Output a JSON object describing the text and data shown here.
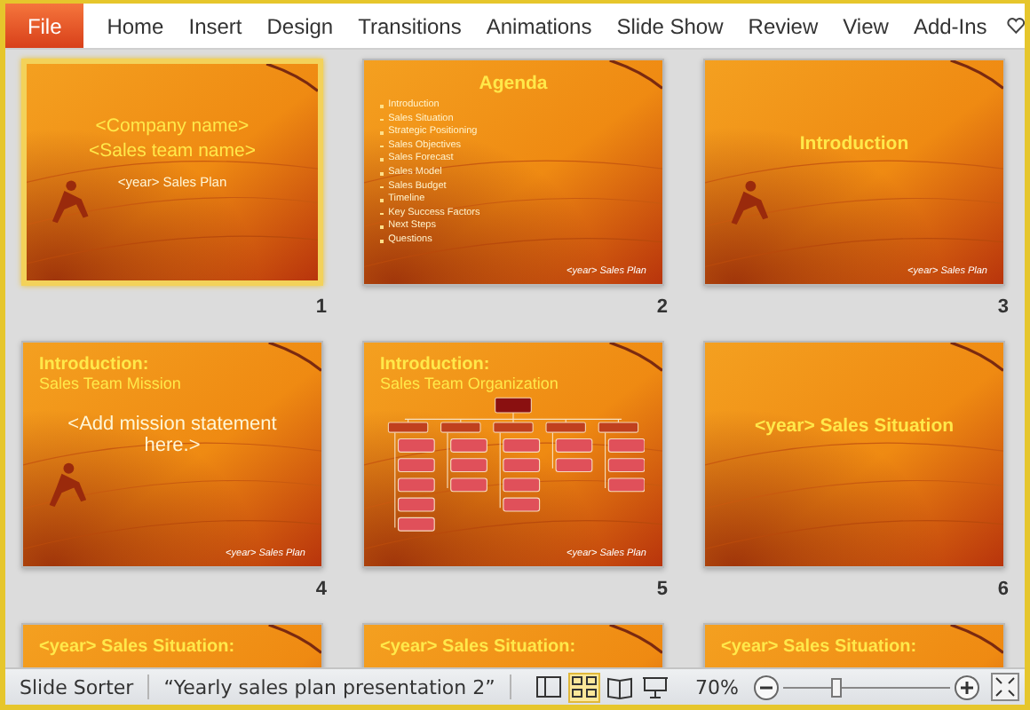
{
  "ribbon": {
    "tabs": [
      {
        "label": "File",
        "kind": "file",
        "selected": false
      },
      {
        "label": "Home",
        "kind": "tab",
        "selected": false
      },
      {
        "label": "Insert",
        "kind": "tab",
        "selected": false
      },
      {
        "label": "Design",
        "kind": "tab",
        "selected": false
      },
      {
        "label": "Transitions",
        "kind": "tab",
        "selected": false
      },
      {
        "label": "Animations",
        "kind": "tab",
        "selected": false
      },
      {
        "label": "Slide Show",
        "kind": "tab",
        "selected": false
      },
      {
        "label": "Review",
        "kind": "tab",
        "selected": false
      },
      {
        "label": "View",
        "kind": "tab",
        "selected": false
      },
      {
        "label": "Add-Ins",
        "kind": "tab",
        "selected": false
      }
    ]
  },
  "slides": [
    {
      "number": "1",
      "kind": "title",
      "selected": true,
      "title": "<Company name>",
      "subtitle": "<Sales team name>",
      "note": "<year>  Sales Plan"
    },
    {
      "number": "2",
      "kind": "bullets",
      "selected": false,
      "title": "Agenda",
      "bullets": [
        "Introduction",
        "Sales Situation",
        "Strategic Positioning",
        "Sales Objectives",
        "Sales Forecast",
        "Sales Model",
        "Sales Budget",
        "Timeline",
        "Key Success Factors",
        "Next Steps",
        "Questions"
      ],
      "footer": "<year> Sales Plan"
    },
    {
      "number": "3",
      "kind": "section",
      "selected": false,
      "title": "Introduction",
      "footer": "<year> Sales Plan"
    },
    {
      "number": "4",
      "kind": "content",
      "selected": false,
      "title": "Introduction:",
      "subtitle": "Sales Team Mission",
      "body": "<Add mission statement here.>",
      "footer": "<year> Sales Plan"
    },
    {
      "number": "5",
      "kind": "orgchart",
      "selected": false,
      "title": "Introduction:",
      "subtitle": "Sales Team Organization",
      "footer": "<year> Sales Plan"
    },
    {
      "number": "6",
      "kind": "section",
      "selected": false,
      "title": "<year> Sales Situation"
    },
    {
      "kind": "content",
      "selected": false,
      "title": "<year> Sales Situation:"
    },
    {
      "kind": "content",
      "selected": false,
      "title": "<year> Sales Situation:"
    },
    {
      "kind": "content",
      "selected": false,
      "title": "<year> Sales Situation:"
    }
  ],
  "status_bar": {
    "view_name": "Slide Sorter",
    "document": "“Yearly sales plan presentation 2”",
    "views": [
      {
        "kind": "normal",
        "selected": false
      },
      {
        "kind": "sorter",
        "selected": true
      },
      {
        "kind": "reading",
        "selected": false
      },
      {
        "kind": "slideshow",
        "selected": false
      }
    ],
    "zoom": "70%",
    "zoom_slider": {
      "level": 0.33
    }
  }
}
